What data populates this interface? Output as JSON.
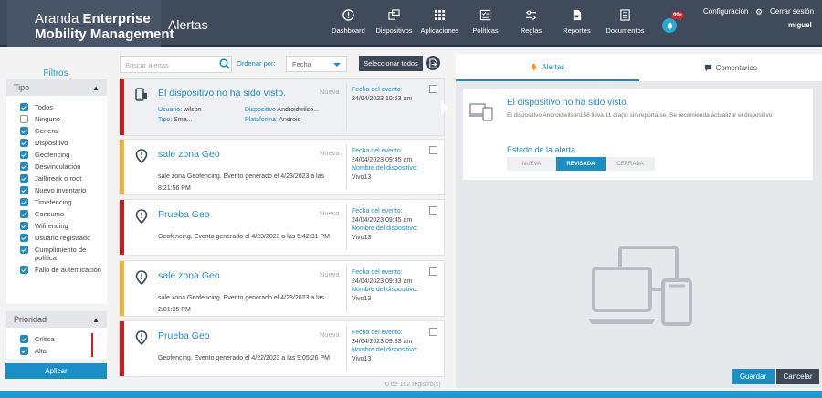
{
  "brand": {
    "line1_prefix": "Aranda",
    "line1_bold": "Enterprise",
    "line2": "Mobility Management"
  },
  "header": {
    "title": "Alertas",
    "nav": [
      {
        "label": "Dashboard",
        "icon": "dashboard-icon"
      },
      {
        "label": "Dispositivos",
        "icon": "devices-icon"
      },
      {
        "label": "Aplicaciones",
        "icon": "apps-grid-icon"
      },
      {
        "label": "Políticas",
        "icon": "policies-icon"
      },
      {
        "label": "Reglas",
        "icon": "rules-icon"
      },
      {
        "label": "Reportes",
        "icon": "reports-icon"
      },
      {
        "label": "Documentos",
        "icon": "documents-icon"
      }
    ],
    "notifications_badge": "99+",
    "config": "Configuración",
    "logout": "Cerrar sesión",
    "user": "miguel"
  },
  "filters": {
    "title": "Filtros",
    "tipo": {
      "label": "Tipo",
      "items": [
        {
          "label": "Todos",
          "checked": true
        },
        {
          "label": "Ninguno",
          "checked": false
        },
        {
          "label": "General",
          "checked": true
        },
        {
          "label": "Dispositivo",
          "checked": true
        },
        {
          "label": "Geofencing",
          "checked": true
        },
        {
          "label": "Desvinculación",
          "checked": true
        },
        {
          "label": "Jailbreak o root",
          "checked": true
        },
        {
          "label": "Nuevo inventario",
          "checked": true
        },
        {
          "label": "Timefencing",
          "checked": true
        },
        {
          "label": "Consumo",
          "checked": true
        },
        {
          "label": "Wififencing",
          "checked": true
        },
        {
          "label": "Usuario registrado",
          "checked": true
        },
        {
          "label": "Cumplimiento de política",
          "checked": true
        },
        {
          "label": "Fallo de autenticación",
          "checked": true
        }
      ]
    },
    "prioridad": {
      "label": "Prioridad",
      "items": [
        {
          "label": "Crítica",
          "checked": true
        },
        {
          "label": "Alta",
          "checked": true
        }
      ]
    },
    "apply": "Aplicar"
  },
  "toolbar": {
    "search_placeholder": "Buscar alertas",
    "order_label": "Ordenar por:",
    "order_value": "Fecha",
    "select_all": "Seleccionar todos"
  },
  "alerts": [
    {
      "title": "El dispositivo no ha sido visto.",
      "state": "Nueva",
      "priority_color": "#d11c1c",
      "kind": "device",
      "usuario_label": "Usuario:",
      "usuario": "wilson",
      "tipo_label": "Tipo:",
      "tipo": "Sma...",
      "dispositivo_label": "Dispositivo",
      "dispositivo": "Androidwilso...",
      "plataforma_label": "Plataforma:",
      "plataforma": "Android",
      "fecha_label": "Fecha del evento:",
      "fecha": "24/04/2023 10:53 am"
    },
    {
      "title": "sale zona Geo",
      "state": "Nueva",
      "priority_color": "#f0b43c",
      "kind": "geo",
      "desc": "sale zona Geofencing. Evento generado el 4/23/2023 a las 8:21:56 PM",
      "fecha_label": "Fecha del evento:",
      "fecha": "24/04/2023 09:45 am",
      "device_label": "Nombre del dispositivo:",
      "device": "Vivo13"
    },
    {
      "title": "Prueba Geo",
      "state": "Nueva",
      "priority_color": "#d11c1c",
      "kind": "geo",
      "desc": "Geofencing. Evento generado el 4/23/2023 a las 5:42:31 PM",
      "fecha_label": "Fecha del evento:",
      "fecha": "24/04/2023 09:45 am",
      "device_label": "Nombre del dispositivo:",
      "device": "Vivo13"
    },
    {
      "title": "sale zona Geo",
      "state": "Nueva",
      "priority_color": "#f0b43c",
      "kind": "geo",
      "desc": "sale zona Geofencing. Evento generado el 4/23/2023 a las 2:01:35 PM",
      "fecha_label": "Fecha del evento:",
      "fecha": "24/04/2023 09:33 am",
      "device_label": "Nombre del dispositivo:",
      "device": "Vivo13"
    },
    {
      "title": "Prueba Geo",
      "state": "Nueva",
      "priority_color": "#d11c1c",
      "kind": "geo",
      "desc": "Geofencing. Evento generado el 4/22/2023 a las 9:05:26 PM",
      "fecha_label": "Fecha del evento:",
      "fecha": "24/04/2023 09:33 am",
      "device_label": "Nombre del dispositivo:",
      "device": "Vivo13"
    }
  ],
  "records": "0 de 162 registro(s)",
  "detail": {
    "tabs": [
      {
        "label": "Alertas",
        "icon": "bell-icon"
      },
      {
        "label": "Comentarios",
        "icon": "comment-icon"
      }
    ],
    "title": "El dispositivo no ha sido visto.",
    "desc": "El dispositivo Androidwilson158 lleva 11 día(s) sin reportarse, Se recomienda actualizar el dispositivo",
    "state_label": "Estado de la alerta",
    "states": [
      "NUEVA",
      "REVISADA",
      "CERRADA"
    ],
    "active_state": "REVISADA"
  },
  "actions": {
    "save": "Guardar",
    "cancel": "Cancelar"
  },
  "colors": {
    "accent": "#1a8fc6",
    "header": "#3f4b5b",
    "critical": "#d11c1c",
    "high": "#f0b43c"
  }
}
